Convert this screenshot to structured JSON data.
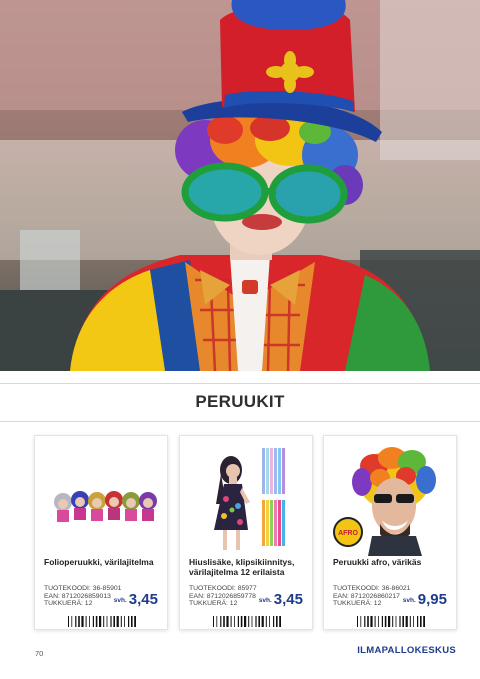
{
  "section": {
    "title": "PERUUKIT"
  },
  "products": [
    {
      "name": "Folioperuukki, värilajitelma",
      "code_label": "TUOTEKOODI: 36-85901",
      "ean_label": "EAN: 8712026859013",
      "pack_label": "TUKKUERÄ: 12",
      "price_prefix": "svh.",
      "price": "3,45",
      "image_icon": "foil-wigs-image"
    },
    {
      "name": "Hiuslisäke, klipsikiinnitys, värilajitelma 12 erilaista",
      "code_label": "TUOTEKOODI: 85977",
      "ean_label": "EAN: 8712026859778",
      "pack_label": "TUKKUERÄ: 12",
      "price_prefix": "svh.",
      "price": "3,45",
      "image_icon": "hair-extension-image"
    },
    {
      "name": "Peruukki afro, värikäs",
      "code_label": "TUOTEKOODI: 36-86021",
      "ean_label": "EAN: 8712026860217",
      "pack_label": "TUKKUERÄ: 12",
      "price_prefix": "svh.",
      "price": "9,95",
      "image_icon": "afro-wig-image",
      "image_badge": "AFRO"
    }
  ],
  "footer": {
    "page_number": "70",
    "brand": "ILMAPALLOKESKUS"
  },
  "colors": {
    "brand_blue": "#1f3b8c",
    "title_gray": "#2f2f2f"
  }
}
